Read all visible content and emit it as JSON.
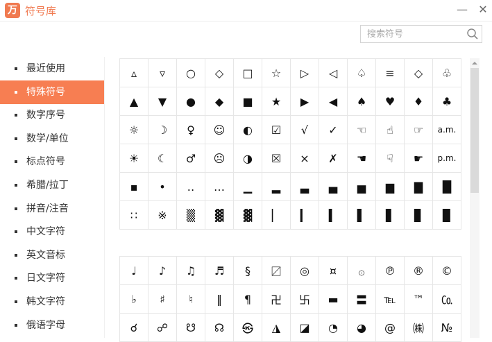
{
  "app": {
    "logo_text": "万",
    "title": "符号库",
    "minimize_glyph": "—",
    "close_glyph": "✕"
  },
  "search": {
    "placeholder": "搜索符号",
    "value": ""
  },
  "sidebar": {
    "items": [
      {
        "label": "最近使用",
        "active": false
      },
      {
        "label": "特殊符号",
        "active": true
      },
      {
        "label": "数字序号",
        "active": false
      },
      {
        "label": "数学/单位",
        "active": false
      },
      {
        "label": "标点符号",
        "active": false
      },
      {
        "label": "希腊/拉丁",
        "active": false
      },
      {
        "label": "拼音/注音",
        "active": false
      },
      {
        "label": "中文字符",
        "active": false
      },
      {
        "label": "英文音标",
        "active": false
      },
      {
        "label": "日文字符",
        "active": false
      },
      {
        "label": "韩文字符",
        "active": false
      },
      {
        "label": "俄语字母",
        "active": false
      }
    ]
  },
  "symbols_group1": [
    [
      "▵",
      "▿",
      "○",
      "◇",
      "□",
      "☆",
      "▷",
      "◁",
      "♤",
      "≡",
      "◇",
      "♧"
    ],
    [
      "▲",
      "▼",
      "●",
      "◆",
      "■",
      "★",
      "▶",
      "◀",
      "♠",
      "♥",
      "♦",
      "♣"
    ],
    [
      "☼",
      "☽",
      "♀",
      "☺",
      "◐",
      "☑",
      "√",
      "✓",
      "☜",
      "☝",
      "☞",
      "a.m."
    ],
    [
      "☀",
      "☾",
      "♂",
      "☹",
      "◑",
      "☒",
      "×",
      "✗",
      "☚",
      "☟",
      "☛",
      "p.m."
    ],
    [
      "▪",
      "•",
      "‥",
      "…",
      "▁",
      "▂",
      "▃",
      "▄",
      "▅",
      "▆",
      "▇",
      "█"
    ],
    [
      "∷",
      "※",
      "▒",
      "▓",
      "▓",
      "▏",
      "▎",
      "▍",
      "▌",
      "▋",
      "▊",
      "▉"
    ]
  ],
  "symbols_group2": [
    [
      "♩",
      "♪",
      "♫",
      "♬",
      "§",
      "〼",
      "◎",
      "¤",
      "۞",
      "℗",
      "®",
      "©"
    ],
    [
      "♭",
      "♯",
      "♮",
      "‖",
      "¶",
      "卍",
      "卐",
      "▬",
      "〓",
      "℡",
      "™",
      "㏇"
    ],
    [
      "☌",
      "☍",
      "☋",
      "☊",
      "㉿",
      "◮",
      "◪",
      "◔",
      "◕",
      "@",
      "㈱",
      "№"
    ]
  ]
}
